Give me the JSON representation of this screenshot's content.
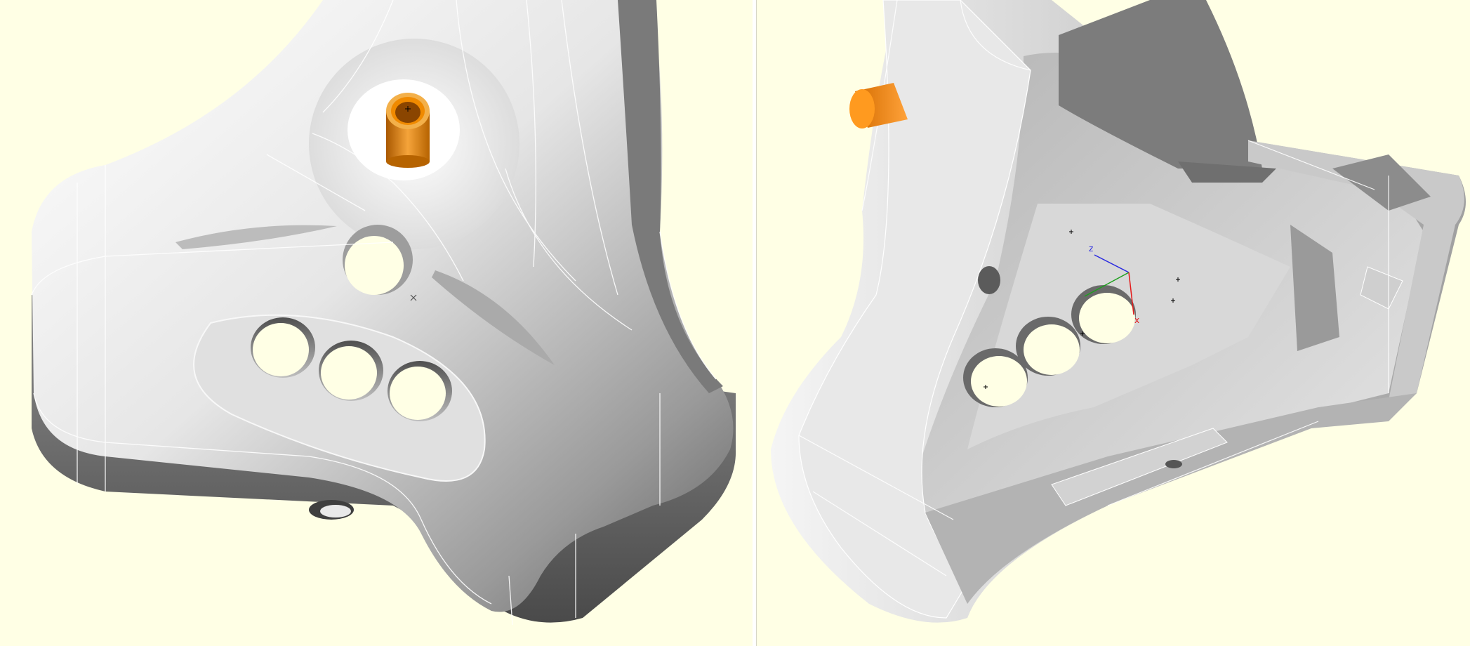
{
  "colors": {
    "background": "#ffffe5",
    "model_light": "#f4f4f4",
    "model_mid": "#bdbdbd",
    "model_dark": "#5f5f5f",
    "edge_lines": "#ffffff",
    "pin_orange": "#f08a00",
    "axis_x": "#e41a1a",
    "axis_y": "#1ea01e",
    "axis_z": "#2a2ae0"
  },
  "left_view": {
    "model": "knob-shell-exterior",
    "icons": [
      "orange-pin-icon",
      "center-x-marker-icon"
    ]
  },
  "right_view": {
    "model": "knob-shell-interior",
    "axis": {
      "x_label": "x",
      "z_label": "z"
    },
    "icons": [
      "orange-pin-icon",
      "axis-triad-icon",
      "plus-marker-icon"
    ]
  }
}
